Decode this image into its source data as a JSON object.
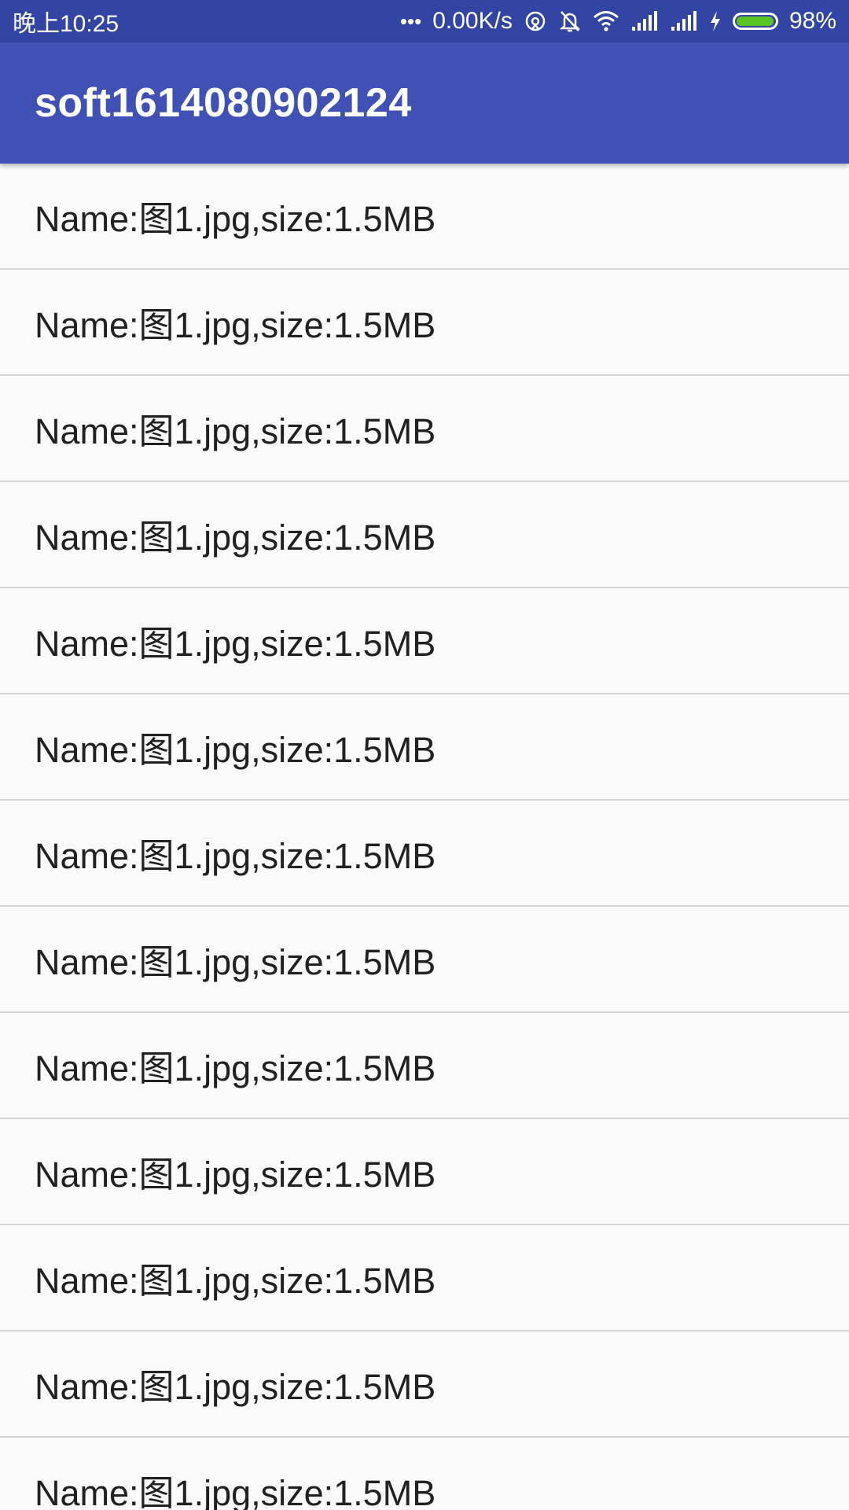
{
  "status_bar": {
    "time": "晚上10:25",
    "dots": "•••",
    "network_speed": "0.00K/s",
    "battery_percent": "98%",
    "battery_level": 0.98,
    "icons": [
      "sync-icon",
      "bell-muted-icon",
      "wifi-icon",
      "signal-icon",
      "signal-icon",
      "charging-icon",
      "battery-icon"
    ]
  },
  "app_bar": {
    "title": "soft1614080902124"
  },
  "colors": {
    "status_bar": "#3345a4",
    "app_bar": "#3f51b5",
    "background": "#fafafa",
    "battery_fill": "#58c322"
  },
  "list": {
    "items": [
      {
        "label": "Name:图1.jpg,size:1.5MB"
      },
      {
        "label": "Name:图1.jpg,size:1.5MB"
      },
      {
        "label": "Name:图1.jpg,size:1.5MB"
      },
      {
        "label": "Name:图1.jpg,size:1.5MB"
      },
      {
        "label": "Name:图1.jpg,size:1.5MB"
      },
      {
        "label": "Name:图1.jpg,size:1.5MB"
      },
      {
        "label": "Name:图1.jpg,size:1.5MB"
      },
      {
        "label": "Name:图1.jpg,size:1.5MB"
      },
      {
        "label": "Name:图1.jpg,size:1.5MB"
      },
      {
        "label": "Name:图1.jpg,size:1.5MB"
      },
      {
        "label": "Name:图1.jpg,size:1.5MB"
      },
      {
        "label": "Name:图1.jpg,size:1.5MB"
      },
      {
        "label": "Name:图1.jpg,size:1.5MB"
      }
    ]
  }
}
